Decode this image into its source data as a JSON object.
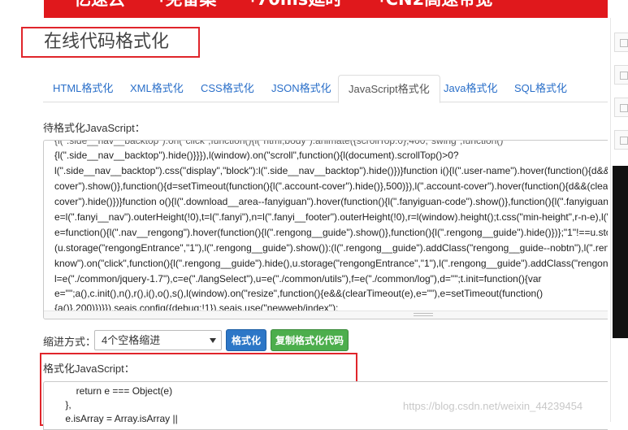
{
  "banner": {
    "items": [
      "亿速云",
      "免备案",
      "70ms延时",
      "CN2高速带宽"
    ]
  },
  "page_title": "在线代码格式化",
  "tabs": [
    {
      "label": "HTML格式化",
      "active": false
    },
    {
      "label": "XML格式化",
      "active": false
    },
    {
      "label": "CSS格式化",
      "active": false
    },
    {
      "label": "JSON格式化",
      "active": false
    },
    {
      "label": "JavaScript格式化",
      "active": true
    },
    {
      "label": "Java格式化",
      "active": false
    },
    {
      "label": "SQL格式化",
      "active": false
    }
  ],
  "input_section": {
    "label": "待格式化JavaScript：",
    "lines": [
      "{l(\".side__nav__backtop\").hide()}}}),l(window).on(\"scroll\",function(){l(document).scrollTop()>0?",
      "l(\".side__nav__backtop\").css(\"display\",\"block\"):l(\".side__nav__backtop\").hide()})}function i(){l(\".user-name\").hover(function(){d&&(",
      "cover\").show()},function(){d=setTimeout(function(){l(\".account-cover\").hide()},500)}),l(\".account-cover\").hover(function(){d&&(clearT",
      "cover\").hide()})}function o(){l(\".download__area--fanyiguan\").hover(function(){l(\".fanyiguan-code\").show()},function(){l(\".fanyiguan-c",
      "e=l(\".fanyi__nav\").outerHeight(!0),t=l(\".fanyi\"),n=l(\".fanyi__footer\").outerHeight(!0),r=l(window).height();t.css(\"min-height\",r-n-e),l(\".",
      "e=function(){l(\".nav__rengong\").hover(function(){l(\".rengong__guide\").show()},function(){l(\".rengong__guide\").hide()})};\"1\"!==u.stor",
      "(u.storage(\"rengongEntrance\",\"1\"),l(\".rengong__guide\").show()):(l(\".rengong__guide\").addClass(\"rengong__guide--nobtn\"),l(\".reng",
      "know\").on(\"click\",function(){l(\".rengong__guide\").hide(),u.storage(\"rengongEntrance\",\"1\"),l(\".rengong__guide\").addClass(\"rengong",
      "l=e(\"./common/jquery-1.7\"),c=e(\"./langSelect\"),u=e(\"./common/utils\"),f=e(\"./common/log\"),d=\"\";t.init=function(){var",
      "e=\"\";a(),c.init(),n(),r(),i(),o(),s(),l(window).on(\"resize\",function(){e&&(clearTimeout(e),e=\"\"),e=setTimeout(function()",
      "{a()},200)})}}),seajs.config({debug:!1}),seajs.use(\"newweb/index\");"
    ]
  },
  "indent": {
    "label": "缩进方式：",
    "selected": "4个空格缩进"
  },
  "buttons": {
    "format": "格式化",
    "copy": "复制格式化代码"
  },
  "output_section": {
    "label": "格式化JavaScript：",
    "lines": [
      "        return e === Object(e)",
      "    },",
      "    e.isArray = Array.isArray ||"
    ]
  },
  "watermark": "https://blog.csdn.net/weixin_44239454"
}
